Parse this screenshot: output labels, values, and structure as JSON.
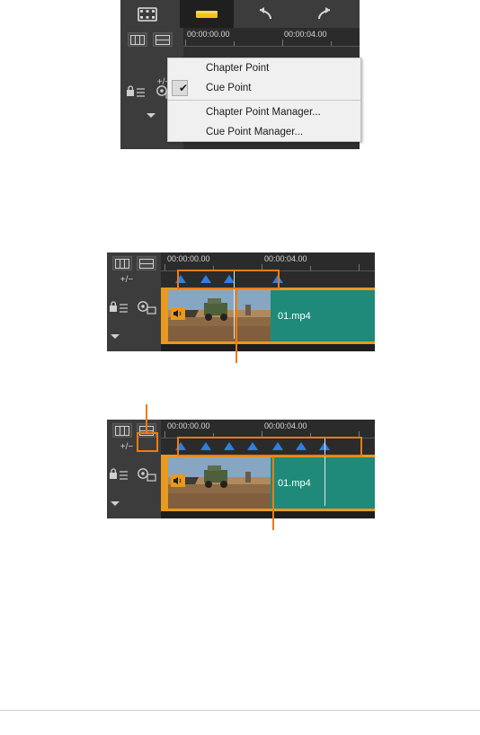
{
  "page": {
    "background": "#ffffff",
    "accent_orange": "#ef7b10",
    "marker_blue": "#2f7fe0",
    "clip_green": "#1f8a7a",
    "selected_tab_underline": "#f0c419"
  },
  "figure1": {
    "name": "timeline-toolbar-with-marker-menu",
    "toolbar": {
      "buttons": [
        {
          "name": "media-room-icon",
          "glyph": "film-strip"
        },
        {
          "name": "marker-tool-icon",
          "glyph": "marker",
          "selected": true
        },
        {
          "name": "undo-icon",
          "glyph": "undo-arrow"
        },
        {
          "name": "redo-icon",
          "glyph": "redo-arrow"
        }
      ]
    },
    "ruler": {
      "labels": [
        "00:00:00.00",
        "00:00:04.00"
      ]
    },
    "track_buttons": [
      {
        "name": "track-manager-icon"
      },
      {
        "name": "track-add-icon"
      },
      {
        "name": "marker-add-remove-icon",
        "label": "+/−"
      },
      {
        "name": "track-collapse-icon",
        "glyph": "chevron-down"
      },
      {
        "name": "lock-track-icon"
      },
      {
        "name": "fx-track-icon"
      }
    ],
    "menu": {
      "items": [
        {
          "label": "Chapter Point",
          "checked": false
        },
        {
          "label": "Cue Point",
          "checked": true
        },
        {
          "separator": true
        },
        {
          "label": "Chapter Point Manager...",
          "checked": false
        },
        {
          "label": "Cue Point Manager...",
          "checked": false
        }
      ]
    }
  },
  "figure2": {
    "name": "timeline-with-four-cue-points",
    "ruler": {
      "labels": [
        "00:00:00.00",
        "00:00:04.00"
      ]
    },
    "clip": {
      "label": "01.mp4"
    },
    "markers_count": 4,
    "highlight": {
      "type": "rectangle-around-markers"
    }
  },
  "figure3": {
    "name": "timeline-with-seven-cue-points",
    "ruler": {
      "labels": [
        "00:00:00.00",
        "00:00:04.00"
      ]
    },
    "clip": {
      "label": "01.mp4"
    },
    "markers_count": 7,
    "highlight": {
      "type": "rectangle-around-markers-and-button"
    }
  }
}
